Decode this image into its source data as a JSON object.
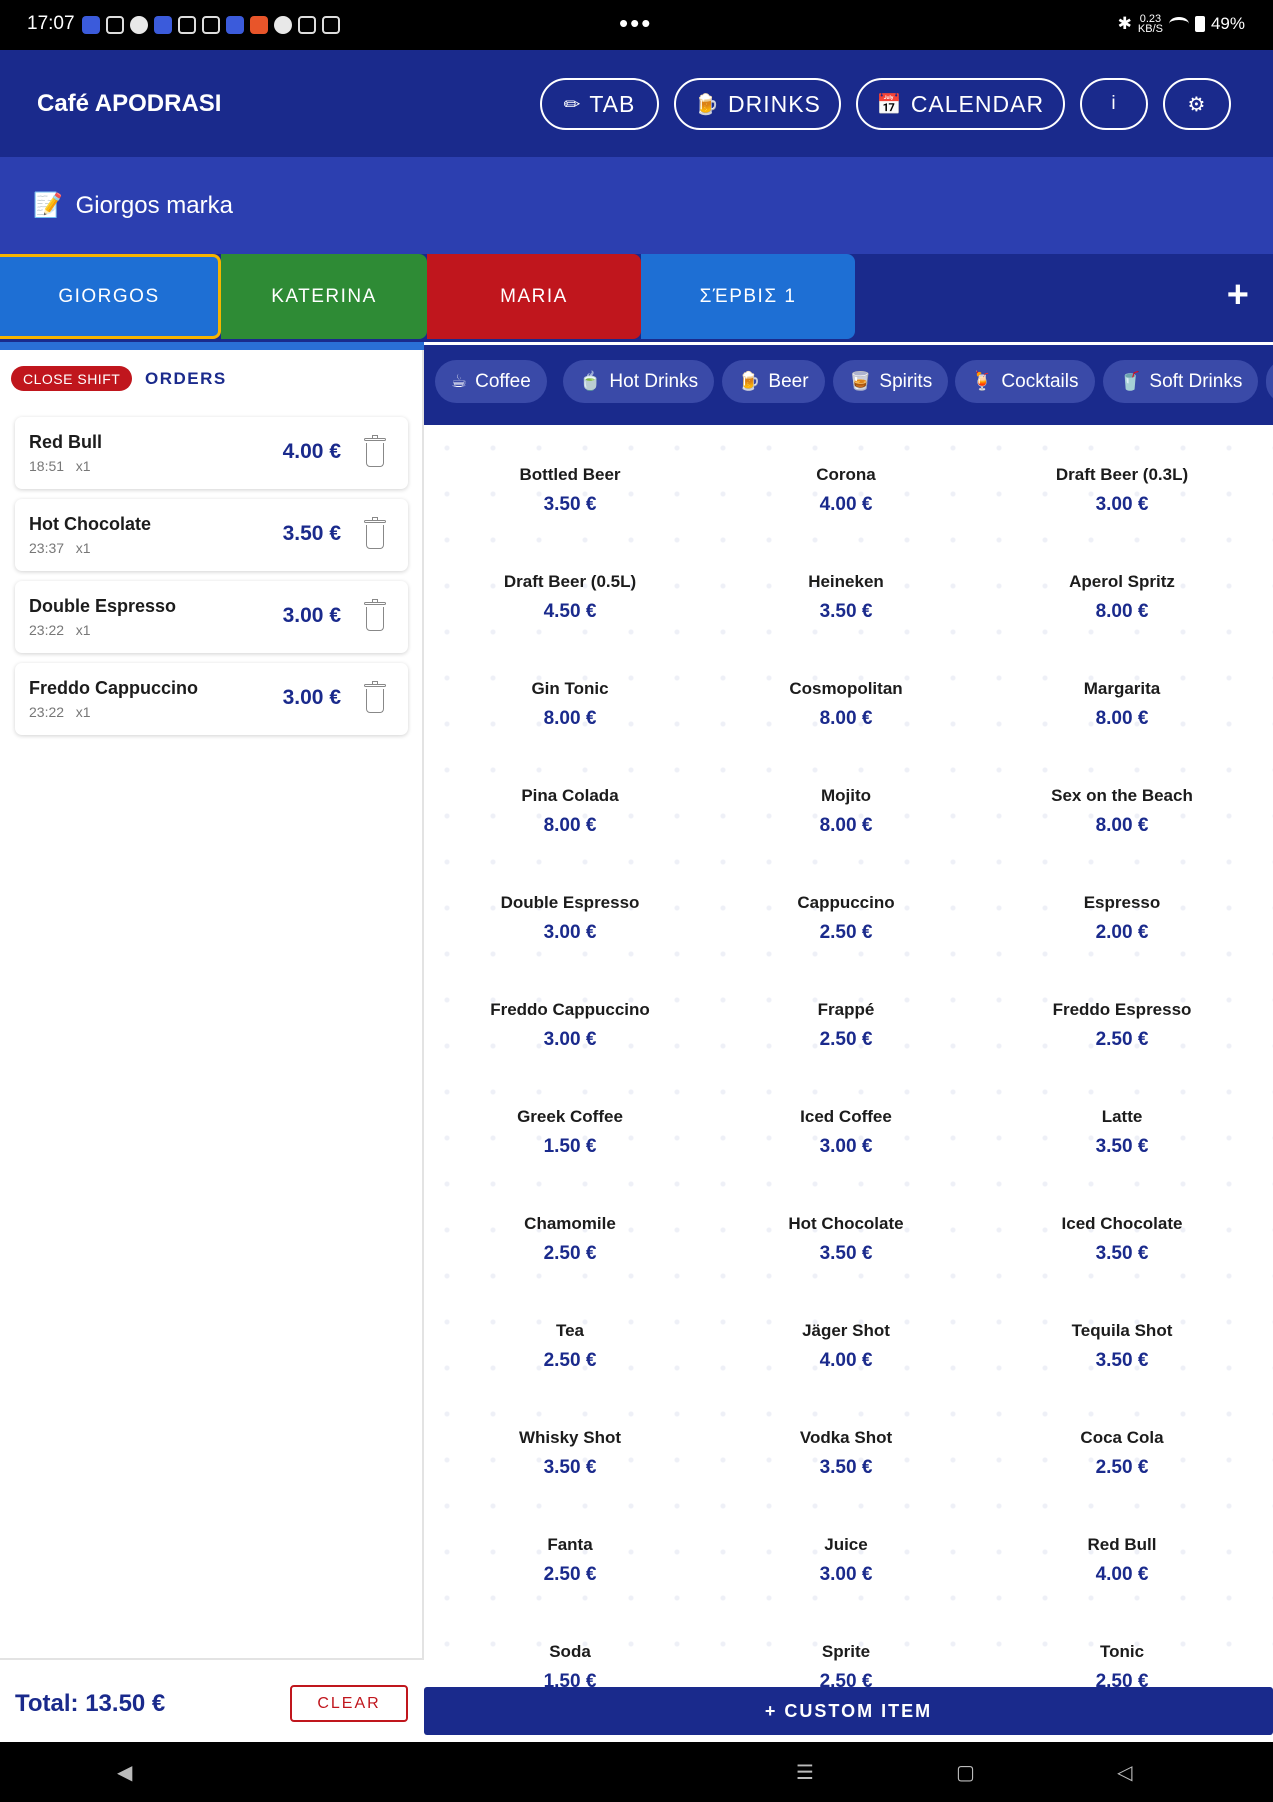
{
  "status_bar": {
    "time": "17:07",
    "dots": "•••",
    "speed_value": "0.23",
    "speed_unit": "KB/S",
    "battery": "49%"
  },
  "header": {
    "title": "Café APODRASI",
    "buttons": [
      {
        "icon": "✏",
        "label": "TAB"
      },
      {
        "icon": "🍺",
        "label": "DRINKS"
      },
      {
        "icon": "📅",
        "label": "CALENDAR"
      },
      {
        "icon": "",
        "label": "i"
      },
      {
        "icon": "⚙",
        "label": ""
      }
    ]
  },
  "note": {
    "icon": "📝",
    "text": "Giorgos marka"
  },
  "staff_tabs": [
    {
      "label": "GIORGOS",
      "color": "#1e6fd4",
      "active": true
    },
    {
      "label": "KATERINA",
      "color": "#2e8b35",
      "active": false
    },
    {
      "label": "MARIA",
      "color": "#c0161d",
      "active": false
    },
    {
      "label": "ΣΈΡΒΙΣ 1",
      "color": "#1e6fd4",
      "active": false
    }
  ],
  "add_tab_label": "+",
  "orders_panel": {
    "close_shift_label": "CLOSE SHIFT",
    "title": "ORDERS",
    "orders": [
      {
        "name": "Red Bull",
        "time": "18:51",
        "qty": "x1",
        "price": "4.00 €"
      },
      {
        "name": "Hot Chocolate",
        "time": "23:37",
        "qty": "x1",
        "price": "3.50 €"
      },
      {
        "name": "Double Espresso",
        "time": "23:22",
        "qty": "x1",
        "price": "3.00 €"
      },
      {
        "name": "Freddo Cappuccino",
        "time": "23:22",
        "qty": "x1",
        "price": "3.00 €"
      }
    ],
    "total_label": "Total: 13.50 €",
    "clear_label": "CLEAR"
  },
  "categories": [
    {
      "icon": "☕",
      "label": "Coffee"
    },
    {
      "icon": "🍵",
      "label": "Hot Drinks"
    },
    {
      "icon": "🍺",
      "label": "Beer"
    },
    {
      "icon": "🥃",
      "label": "Spirits"
    },
    {
      "icon": "🍹",
      "label": "Cocktails"
    },
    {
      "icon": "🥤",
      "label": "Soft Drinks"
    }
  ],
  "menu_items": [
    {
      "name": "Bottled Beer",
      "price": "3.50 €"
    },
    {
      "name": "Corona",
      "price": "4.00 €"
    },
    {
      "name": "Draft Beer (0.3L)",
      "price": "3.00 €"
    },
    {
      "name": "Draft Beer (0.5L)",
      "price": "4.50 €"
    },
    {
      "name": "Heineken",
      "price": "3.50 €"
    },
    {
      "name": "Aperol Spritz",
      "price": "8.00 €"
    },
    {
      "name": "Gin Tonic",
      "price": "8.00 €"
    },
    {
      "name": "Cosmopolitan",
      "price": "8.00 €"
    },
    {
      "name": "Margarita",
      "price": "8.00 €"
    },
    {
      "name": "Pina Colada",
      "price": "8.00 €"
    },
    {
      "name": "Mojito",
      "price": "8.00 €"
    },
    {
      "name": "Sex on the Beach",
      "price": "8.00 €"
    },
    {
      "name": "Double Espresso",
      "price": "3.00 €"
    },
    {
      "name": "Cappuccino",
      "price": "2.50 €"
    },
    {
      "name": "Espresso",
      "price": "2.00 €"
    },
    {
      "name": "Freddo Cappuccino",
      "price": "3.00 €"
    },
    {
      "name": "Frappé",
      "price": "2.50 €"
    },
    {
      "name": "Freddo Espresso",
      "price": "2.50 €"
    },
    {
      "name": "Greek Coffee",
      "price": "1.50 €"
    },
    {
      "name": "Iced Coffee",
      "price": "3.00 €"
    },
    {
      "name": "Latte",
      "price": "3.50 €"
    },
    {
      "name": "Chamomile",
      "price": "2.50 €"
    },
    {
      "name": "Hot Chocolate",
      "price": "3.50 €"
    },
    {
      "name": "Iced Chocolate",
      "price": "3.50 €"
    },
    {
      "name": "Tea",
      "price": "2.50 €"
    },
    {
      "name": "Jäger Shot",
      "price": "4.00 €"
    },
    {
      "name": "Tequila Shot",
      "price": "3.50 €"
    },
    {
      "name": "Whisky Shot",
      "price": "3.50 €"
    },
    {
      "name": "Vodka Shot",
      "price": "3.50 €"
    },
    {
      "name": "Coca Cola",
      "price": "2.50 €"
    },
    {
      "name": "Fanta",
      "price": "2.50 €"
    },
    {
      "name": "Juice",
      "price": "3.00 €"
    },
    {
      "name": "Red Bull",
      "price": "4.00 €"
    },
    {
      "name": "Soda",
      "price": "1.50 €"
    },
    {
      "name": "Sprite",
      "price": "2.50 €"
    },
    {
      "name": "Tonic",
      "price": "2.50 €"
    }
  ],
  "custom_item_label": "+ CUSTOM ITEM"
}
